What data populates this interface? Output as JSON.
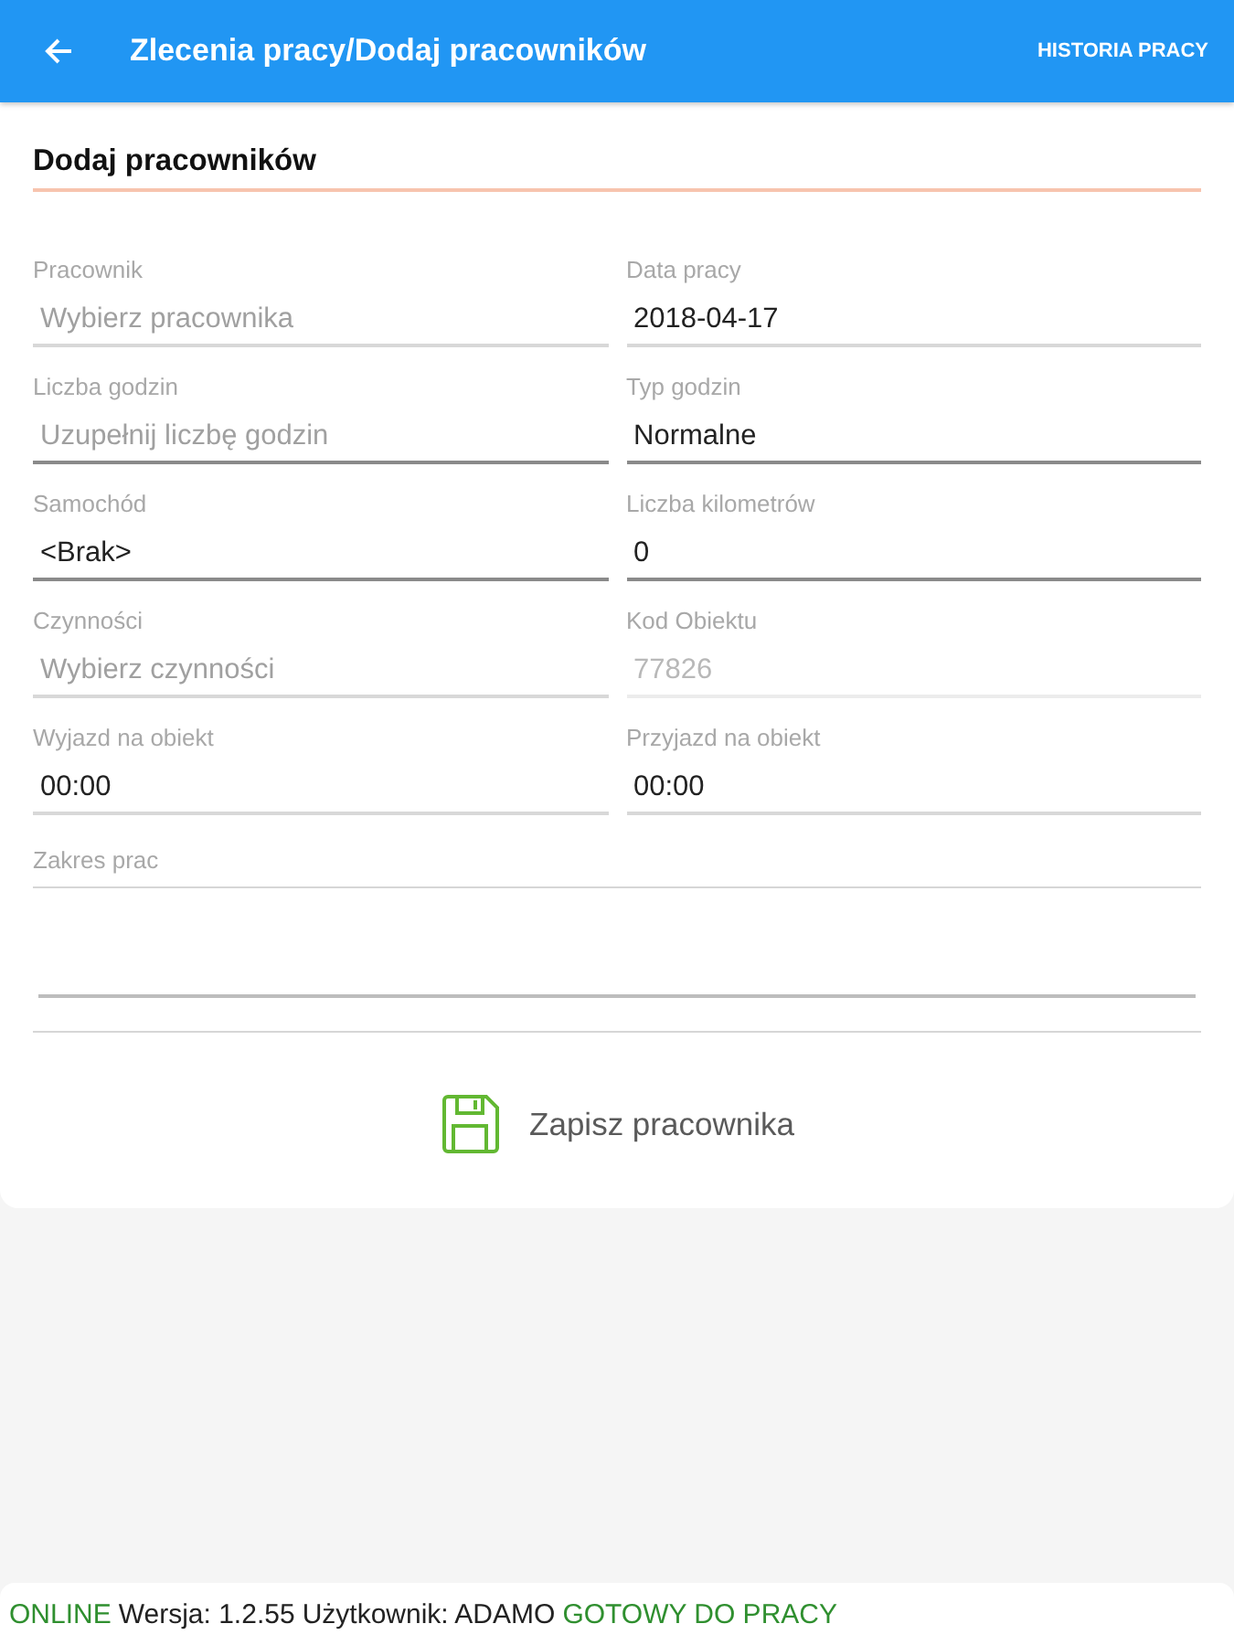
{
  "app_bar": {
    "title": "Zlecenia pracy/Dodaj pracowników",
    "action": "HISTORIA PRACY"
  },
  "form": {
    "title": "Dodaj pracowników",
    "fields": [
      {
        "label": "Pracownik",
        "kind": "picker",
        "placeholder": "Wybierz pracownika",
        "disabled": false
      },
      {
        "label": "Data pracy",
        "kind": "picker",
        "value": "2018-04-17",
        "disabled": false
      },
      {
        "label": "Liczba godzin",
        "kind": "entry",
        "placeholder": "Uzupełnij liczbę godzin",
        "disabled": false
      },
      {
        "label": "Typ godzin",
        "kind": "entry",
        "value": "Normalne",
        "disabled": false
      },
      {
        "label": "Samochód",
        "kind": "entry",
        "value": "<Brak>",
        "disabled": false
      },
      {
        "label": "Liczba kilometrów",
        "kind": "entry",
        "value": "0",
        "disabled": false
      },
      {
        "label": "Czynności",
        "kind": "picker",
        "placeholder": "Wybierz czynności",
        "disabled": false
      },
      {
        "label": "Kod Obiektu",
        "kind": "picker",
        "value": "77826",
        "disabled": true
      },
      {
        "label": "Wyjazd na obiekt",
        "kind": "picker",
        "value": "00:00",
        "disabled": false
      },
      {
        "label": "Przyjazd na obiekt",
        "kind": "picker",
        "value": "00:00",
        "disabled": false
      }
    ],
    "notes": {
      "label": "Zakres prac"
    },
    "save_button": "Zapisz pracownika"
  },
  "status_bar": {
    "connection": "ONLINE",
    "version": "Wersja: 1.2.55",
    "user": "Użytkownik: ADAMO",
    "state": "GOTOWY DO PRACY"
  }
}
